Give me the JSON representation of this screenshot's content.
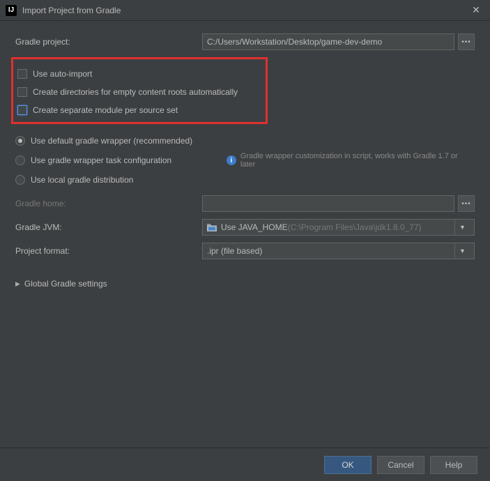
{
  "title": "Import Project from Gradle",
  "labels": {
    "gradle_project": "Gradle project:",
    "gradle_home": "Gradle home:",
    "gradle_jvm": "Gradle JVM:",
    "project_format": "Project format:",
    "global_settings": "Global Gradle settings"
  },
  "fields": {
    "gradle_project_path": "C:/Users/Workstation/Desktop/game-dev-demo",
    "gradle_home_path": "",
    "gradle_jvm_prefix": "Use JAVA_HOME ",
    "gradle_jvm_detail": "(C:\\Program Files\\Java\\jdk1.8.0_77)",
    "project_format_value": ".ipr (file based)"
  },
  "checkboxes": {
    "auto_import": "Use auto-import",
    "create_dirs": "Create directories for empty content roots automatically",
    "separate_modules": "Create separate module per source set"
  },
  "radios": {
    "default_wrapper": "Use default gradle wrapper (recommended)",
    "wrapper_task": "Use gradle wrapper task configuration",
    "local_dist": "Use local gradle distribution"
  },
  "hints": {
    "wrapper_task": "Gradle wrapper customization in script, works with Gradle 1.7 or later"
  },
  "buttons": {
    "ok": "OK",
    "cancel": "Cancel",
    "help": "Help"
  }
}
